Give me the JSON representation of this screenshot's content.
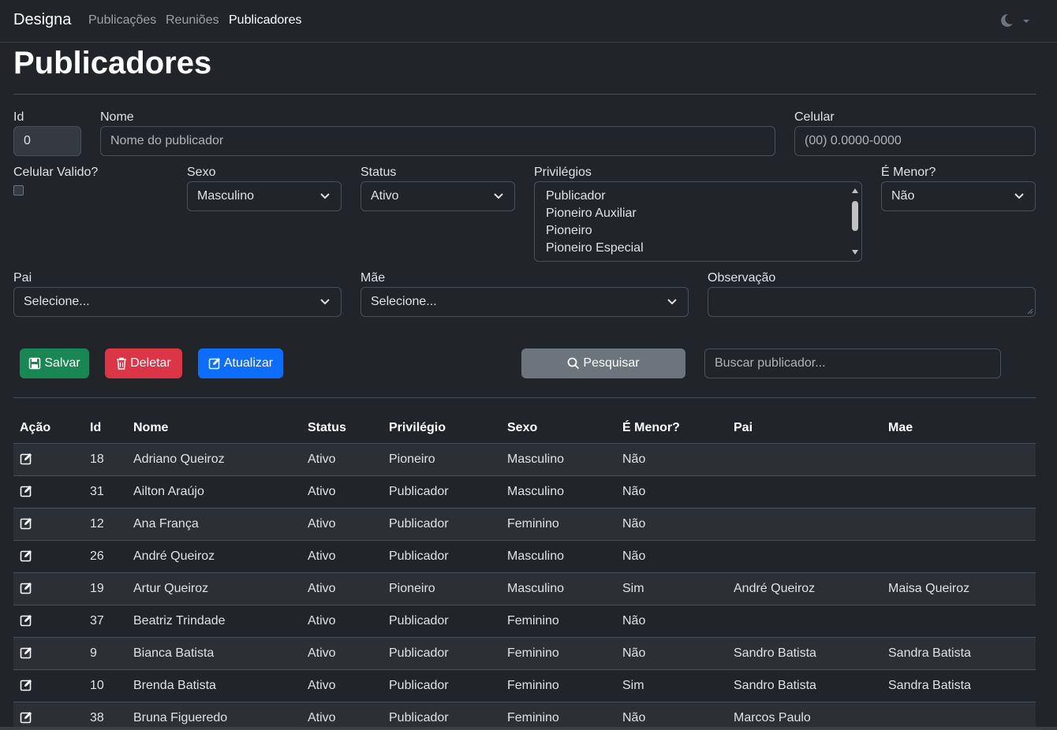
{
  "navbar": {
    "brand": "Designa",
    "links": [
      "Publicações",
      "Reuniões",
      "Publicadores"
    ],
    "active_link": "Publicadores",
    "theme_icon": "moon-icon"
  },
  "page": {
    "title": "Publicadores"
  },
  "form": {
    "id": {
      "label": "Id",
      "value": "0"
    },
    "nome": {
      "label": "Nome",
      "placeholder": "Nome do publicador"
    },
    "celular": {
      "label": "Celular",
      "placeholder": "(00) 0.0000-0000"
    },
    "celular_valido": {
      "label": "Celular Valido?",
      "checked": false
    },
    "sexo": {
      "label": "Sexo",
      "value": "Masculino"
    },
    "status": {
      "label": "Status",
      "value": "Ativo"
    },
    "privilegios": {
      "label": "Privilégios",
      "options": [
        "Publicador",
        "Pioneiro Auxiliar",
        "Pioneiro",
        "Pioneiro Especial"
      ]
    },
    "menor": {
      "label": "É Menor?",
      "value": "Não"
    },
    "pai": {
      "label": "Pai",
      "value": "Selecione..."
    },
    "mae": {
      "label": "Mãe",
      "value": "Selecione..."
    },
    "observacao": {
      "label": "Observação",
      "value": ""
    }
  },
  "actions": {
    "save": "Salvar",
    "delete": "Deletar",
    "update": "Atualizar",
    "search": "Pesquisar",
    "search_placeholder": "Buscar publicador..."
  },
  "colors": {
    "background": "#212529",
    "success": "#198754",
    "danger": "#dc3545",
    "primary": "#0d6efd",
    "secondary": "#6c757d"
  },
  "table": {
    "columns": [
      "Ação",
      "Id",
      "Nome",
      "Status",
      "Privilégio",
      "Sexo",
      "É Menor?",
      "Pai",
      "Mae"
    ],
    "rows": [
      [
        "18",
        "Adriano Queiroz",
        "Ativo",
        "Pioneiro",
        "Masculino",
        "Não",
        "",
        ""
      ],
      [
        "31",
        "Ailton Araújo",
        "Ativo",
        "Publicador",
        "Masculino",
        "Não",
        "",
        ""
      ],
      [
        "12",
        "Ana França",
        "Ativo",
        "Publicador",
        "Feminino",
        "Não",
        "",
        ""
      ],
      [
        "26",
        "André Queiroz",
        "Ativo",
        "Publicador",
        "Masculino",
        "Não",
        "",
        ""
      ],
      [
        "19",
        "Artur Queiroz",
        "Ativo",
        "Pioneiro",
        "Masculino",
        "Sim",
        "André Queiroz",
        "Maisa Queiroz"
      ],
      [
        "37",
        "Beatriz Trindade",
        "Ativo",
        "Publicador",
        "Feminino",
        "Não",
        "",
        ""
      ],
      [
        "9",
        "Bianca Batista",
        "Ativo",
        "Publicador",
        "Feminino",
        "Não",
        "Sandro Batista",
        "Sandra Batista"
      ],
      [
        "10",
        "Brenda Batista",
        "Ativo",
        "Publicador",
        "Feminino",
        "Sim",
        "Sandro Batista",
        "Sandra Batista"
      ],
      [
        "38",
        "Bruna Figueredo",
        "Ativo",
        "Publicador",
        "Feminino",
        "Não",
        "Marcos Paulo",
        ""
      ]
    ]
  }
}
